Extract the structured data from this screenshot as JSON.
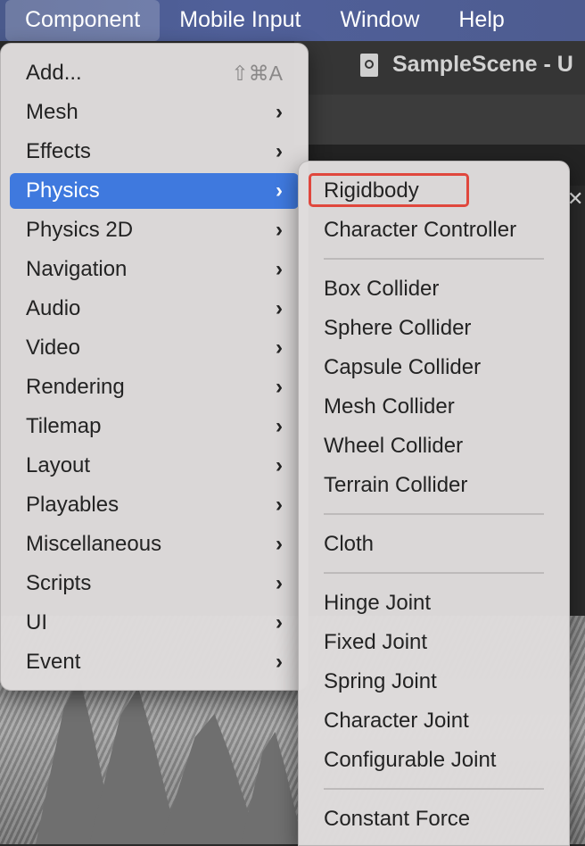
{
  "menubar": {
    "items": [
      "Component",
      "Mobile Input",
      "Window",
      "Help"
    ]
  },
  "editor": {
    "title": "SampleScene - U"
  },
  "component_menu": {
    "items": [
      {
        "label": "Add...",
        "shortcut": "⇧⌘A"
      },
      {
        "label": "Mesh"
      },
      {
        "label": "Effects"
      },
      {
        "label": "Physics",
        "highlighted": true
      },
      {
        "label": "Physics 2D"
      },
      {
        "label": "Navigation"
      },
      {
        "label": "Audio"
      },
      {
        "label": "Video"
      },
      {
        "label": "Rendering"
      },
      {
        "label": "Tilemap"
      },
      {
        "label": "Layout"
      },
      {
        "label": "Playables"
      },
      {
        "label": "Miscellaneous"
      },
      {
        "label": "Scripts"
      },
      {
        "label": "UI"
      },
      {
        "label": "Event"
      }
    ],
    "submenu_arrow": "›"
  },
  "physics_submenu": {
    "items": [
      "Rigidbody",
      "Character Controller",
      "Box Collider",
      "Sphere Collider",
      "Capsule Collider",
      "Mesh Collider",
      "Wheel Collider",
      "Terrain Collider",
      "Cloth",
      "Hinge Joint",
      "Fixed Joint",
      "Spring Joint",
      "Character Joint",
      "Configurable Joint",
      "Constant Force"
    ]
  },
  "colors": {
    "highlight": "#3f79de",
    "annotation": "#e0473d"
  }
}
